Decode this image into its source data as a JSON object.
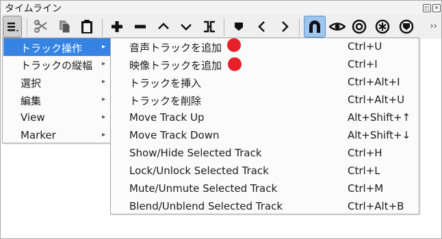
{
  "window": {
    "title": "タイムライン"
  },
  "titlebar_buttons": [
    {
      "name": "float-icon",
      "glyph": "◰"
    },
    {
      "name": "close-icon",
      "glyph": "✕"
    }
  ],
  "toolbar": {
    "tools": [
      {
        "name": "menu-button",
        "icon": "hamburger-menu-icon"
      },
      {
        "name": "cut-button",
        "icon": "scissors-icon"
      },
      {
        "name": "copy-button",
        "icon": "copy-icon"
      },
      {
        "name": "paste-button",
        "icon": "clipboard-icon"
      },
      {
        "name": "append-button",
        "icon": "plus-icon"
      },
      {
        "name": "ripple-delete-button",
        "icon": "minus-icon"
      },
      {
        "name": "lift-button",
        "icon": "chevron-up-icon"
      },
      {
        "name": "overwrite-button",
        "icon": "chevron-down-icon"
      },
      {
        "name": "split-button",
        "icon": "split-icon"
      },
      {
        "name": "add-marker-button",
        "icon": "marker-icon"
      },
      {
        "name": "prev-marker-button",
        "icon": "chevron-left-icon"
      },
      {
        "name": "next-marker-button",
        "icon": "chevron-right-icon"
      },
      {
        "name": "snap-button",
        "icon": "magnet-icon",
        "active": true
      },
      {
        "name": "scrub-button",
        "icon": "eye-icon"
      },
      {
        "name": "ripple-button",
        "icon": "target-icon"
      },
      {
        "name": "ripple-all-button",
        "icon": "asterisk-icon"
      },
      {
        "name": "ripple-markers-button",
        "icon": "shield-icon"
      }
    ],
    "overflow": "››"
  },
  "main_menu": {
    "items": [
      {
        "label": "トラック操作",
        "active": true
      },
      {
        "label": "トラックの縦幅",
        "active": false
      },
      {
        "label": "選択",
        "active": false
      },
      {
        "label": "編集",
        "active": false
      },
      {
        "label": "View",
        "active": false
      },
      {
        "label": "Marker",
        "active": false
      }
    ],
    "submenu_arrow": "▸"
  },
  "sub_menu": {
    "items": [
      {
        "label": "音声トラックを追加",
        "shortcut": "Ctrl+U"
      },
      {
        "label": "映像トラックを追加",
        "shortcut": "Ctrl+I"
      },
      {
        "label": "トラックを挿入",
        "shortcut": "Ctrl+Alt+I"
      },
      {
        "label": "トラックを削除",
        "shortcut": "Ctrl+Alt+U"
      },
      {
        "label": "Move Track Up",
        "shortcut": "Alt+Shift+↑"
      },
      {
        "label": "Move Track Down",
        "shortcut": "Alt+Shift+↓"
      },
      {
        "label": "Show/Hide Selected Track",
        "shortcut": "Ctrl+H"
      },
      {
        "label": "Lock/Unlock Selected Track",
        "shortcut": "Ctrl+L"
      },
      {
        "label": "Mute/Unmute Selected Track",
        "shortcut": "Ctrl+M"
      },
      {
        "label": "Blend/Unblend Selected Track",
        "shortcut": "Ctrl+Alt+B"
      }
    ]
  },
  "colors": {
    "highlight": "#3584e4",
    "snap_active": "#9fc6ee",
    "marker_dot": "#e8202a"
  }
}
